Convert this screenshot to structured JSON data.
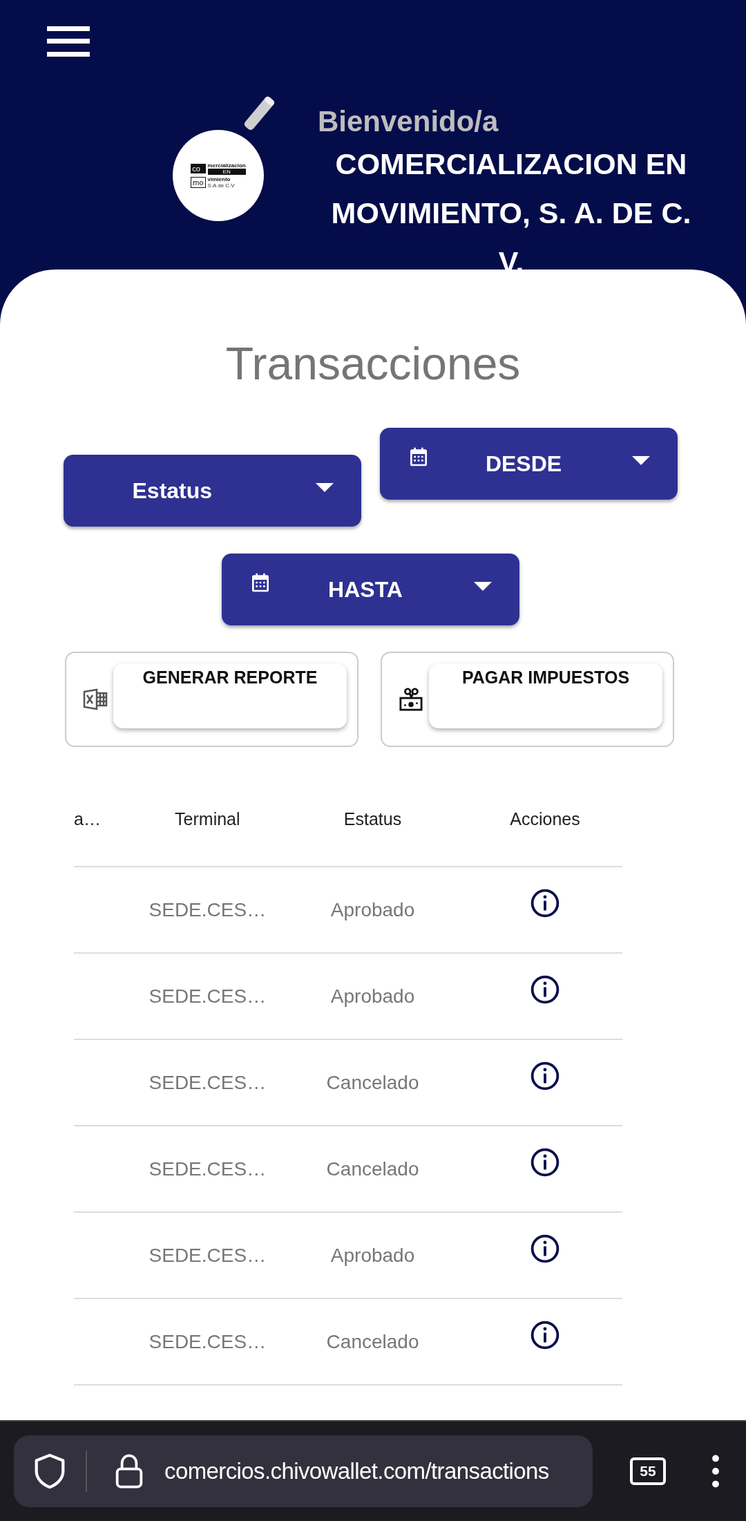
{
  "header": {
    "greeting": "Bienvenido/a",
    "company": "COMERCIALIZACION EN MOVIMIENTO, S. A. DE C. V.",
    "logo": {
      "top_left": "co",
      "bottom_left": "mo",
      "line1": "mercializacion",
      "line2": "EN",
      "line3": "vimiento",
      "suffix": "S.A de C.V"
    }
  },
  "title": "Transacciones",
  "filters": [
    {
      "kind": "dropdown",
      "label": "Estatus"
    },
    {
      "kind": "date",
      "label": "DESDE"
    },
    {
      "kind": "date",
      "label": "HASTA"
    }
  ],
  "actions": [
    {
      "kind": "spreadsheet",
      "label": "GENERAR REPORTE"
    },
    {
      "kind": "money",
      "label": "PAGAR IMPUESTOS"
    }
  ],
  "table": {
    "columns": [
      "a…",
      "Terminal",
      "Estatus",
      "Acciones"
    ],
    "rows": [
      {
        "terminal": "SEDE.CES…",
        "status": "Aprobado"
      },
      {
        "terminal": "SEDE.CES…",
        "status": "Aprobado"
      },
      {
        "terminal": "SEDE.CES…",
        "status": "Cancelado"
      },
      {
        "terminal": "SEDE.CES…",
        "status": "Cancelado"
      },
      {
        "terminal": "SEDE.CES…",
        "status": "Aprobado"
      },
      {
        "terminal": "SEDE.CES…",
        "status": "Cancelado"
      }
    ]
  },
  "browser": {
    "url": "comercios.chivowallet.com/transactions",
    "tab_count": "55"
  }
}
